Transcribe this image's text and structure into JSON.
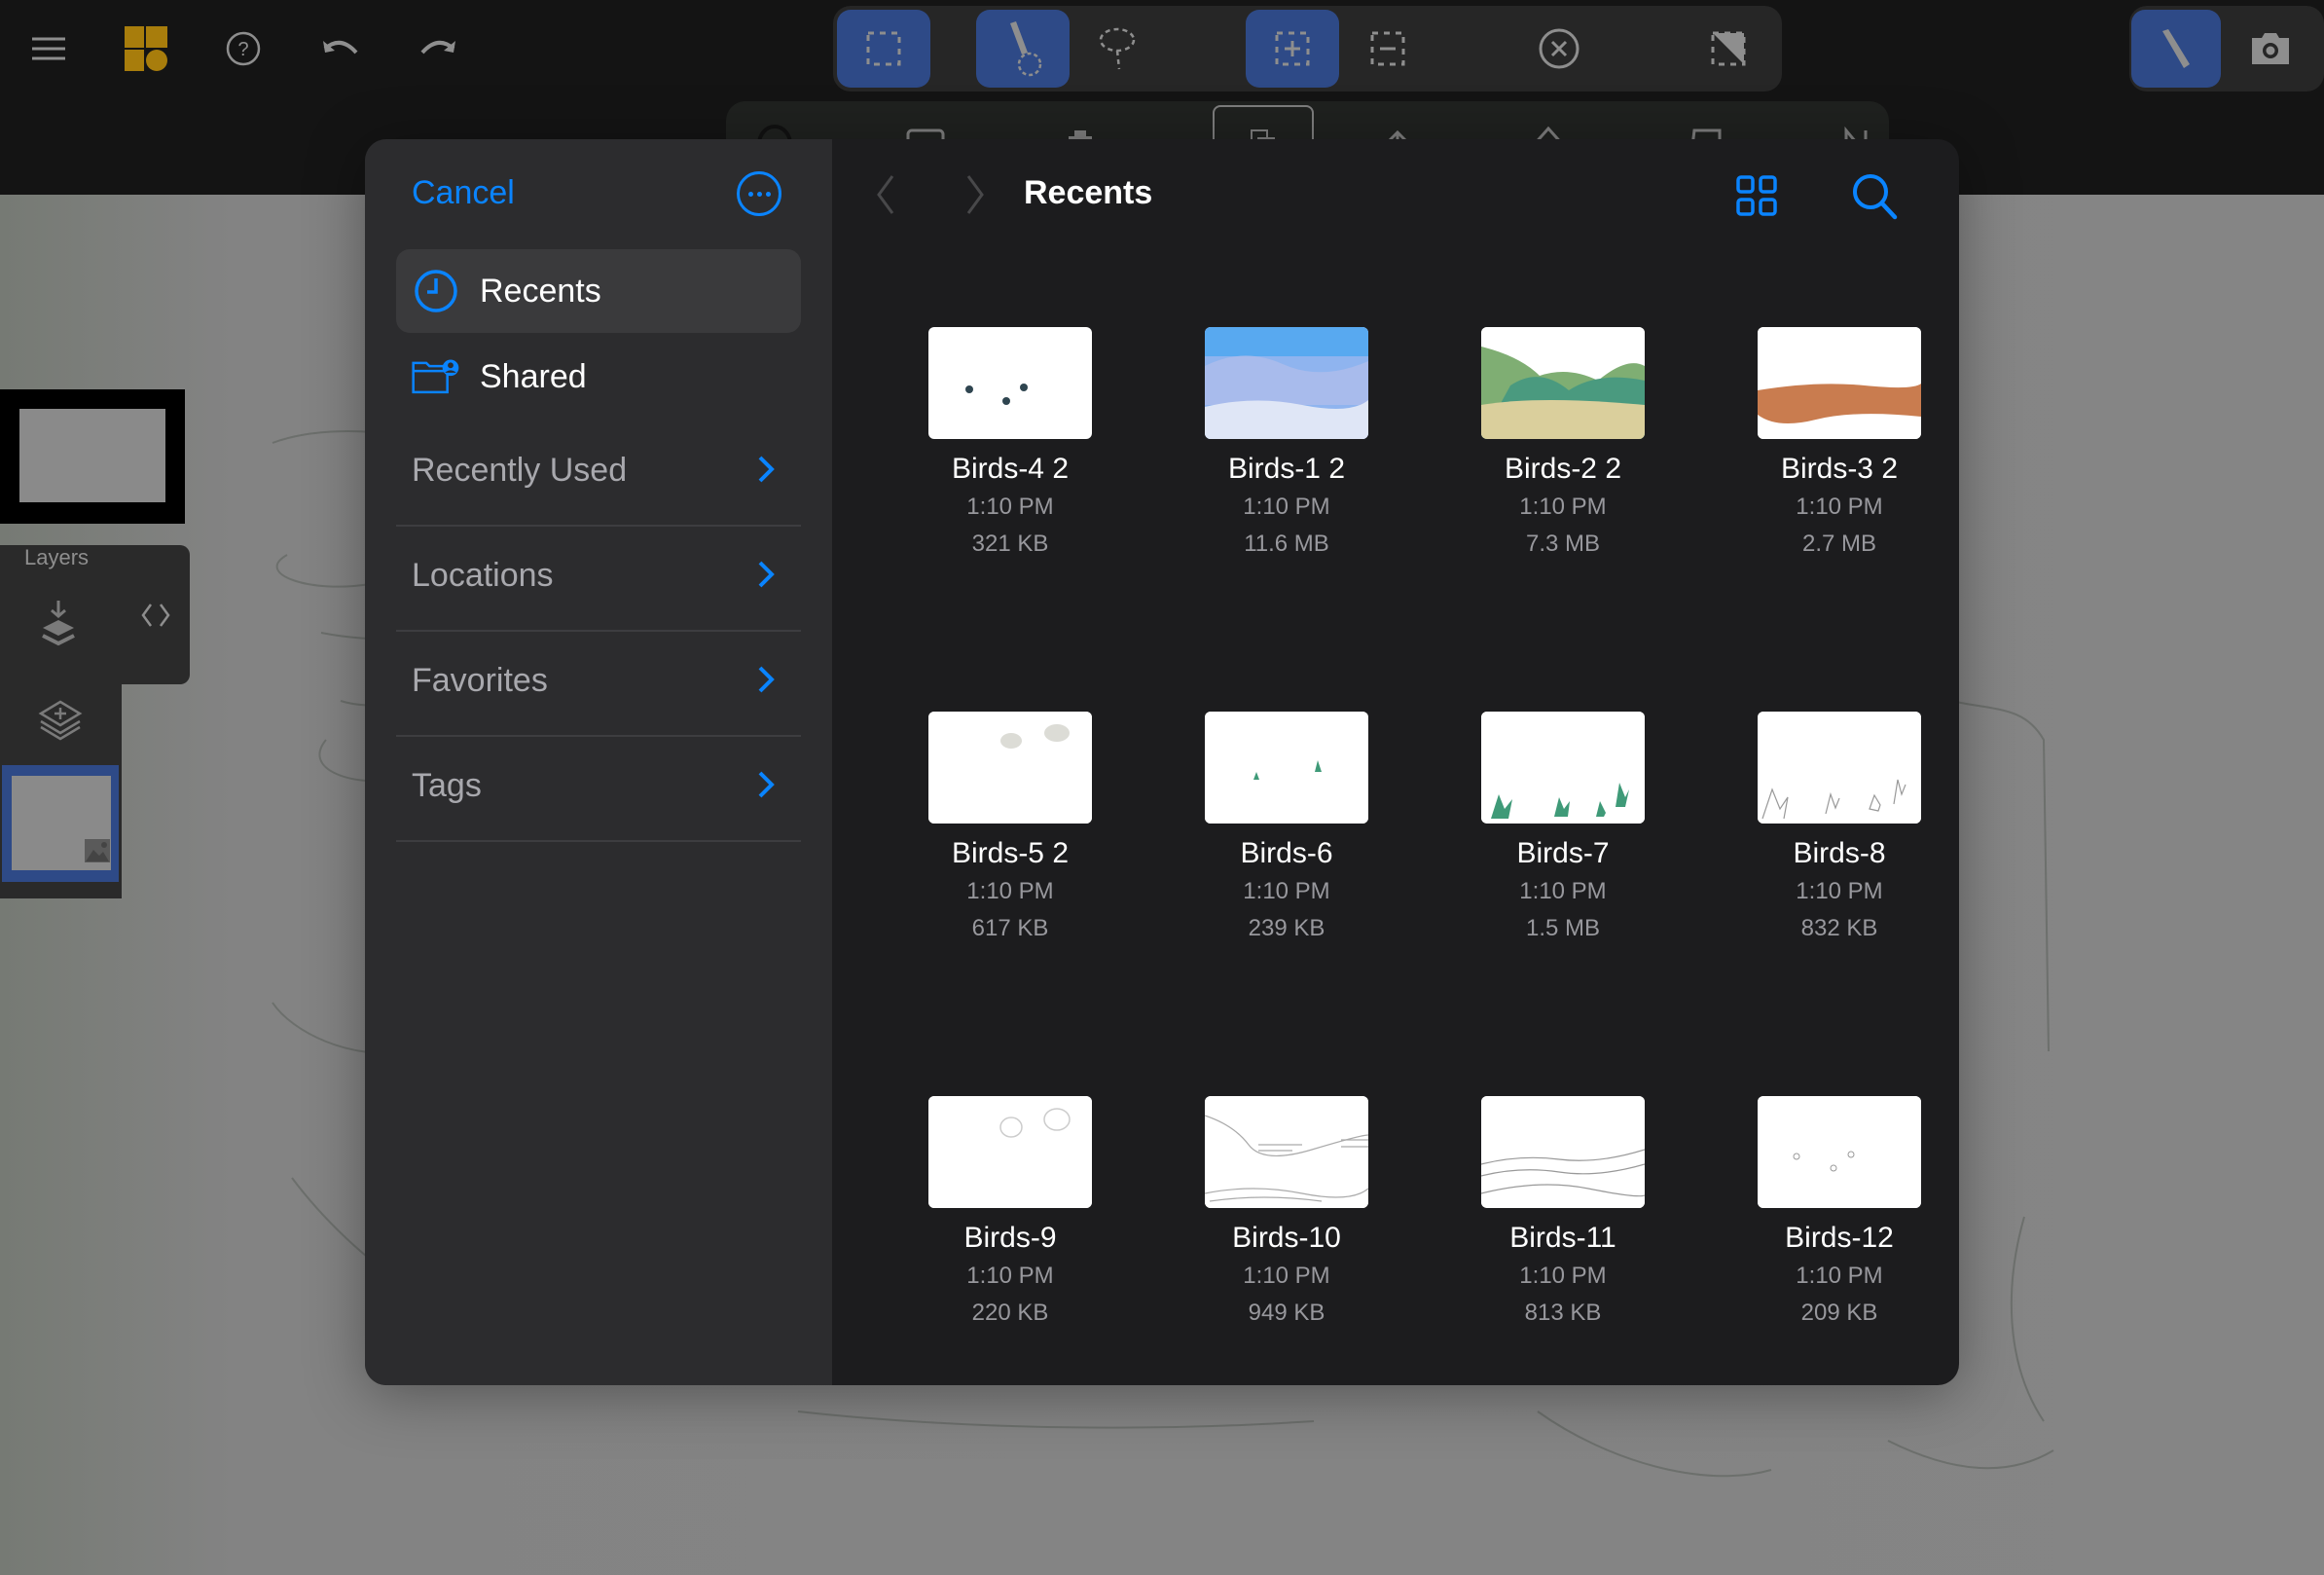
{
  "toolbar": {
    "left_icons": [
      "menu-icon",
      "app-logo-icon",
      "help-icon",
      "undo-icon",
      "redo-icon"
    ],
    "selection_tools": [
      {
        "name": "rectangle-select-icon",
        "active": true
      },
      {
        "name": "brush-select-icon",
        "active": true
      },
      {
        "name": "lasso-select-icon",
        "active": false
      },
      {
        "name": "add-selection-icon",
        "active": true
      },
      {
        "name": "subtract-selection-icon",
        "active": false
      },
      {
        "name": "clear-selection-icon",
        "active": false
      },
      {
        "name": "invert-selection-icon",
        "active": false
      }
    ],
    "right_tools": [
      {
        "name": "brush-icon",
        "active": true
      },
      {
        "name": "camera-icon",
        "active": false
      }
    ]
  },
  "layers_panel": {
    "title": "Layers"
  },
  "file_picker": {
    "cancel_label": "Cancel",
    "accent_color": "#0a84ff",
    "sidebar": {
      "items": [
        {
          "label": "Recents",
          "icon": "clock-icon",
          "active": true
        },
        {
          "label": "Shared",
          "icon": "shared-folder-icon",
          "active": false
        }
      ],
      "sections": [
        {
          "label": "Recently Used"
        },
        {
          "label": "Locations"
        },
        {
          "label": "Favorites"
        },
        {
          "label": "Tags"
        }
      ]
    },
    "header": {
      "title": "Recents"
    },
    "files": [
      {
        "name": "Birds-4 2",
        "time": "1:10 PM",
        "size": "321 KB",
        "thumb": "birds"
      },
      {
        "name": "Birds-1 2",
        "time": "1:10 PM",
        "size": "11.6 MB",
        "thumb": "sky"
      },
      {
        "name": "Birds-2 2",
        "time": "1:10 PM",
        "size": "7.3 MB",
        "thumb": "hills"
      },
      {
        "name": "Birds-3 2",
        "time": "1:10 PM",
        "size": "2.7 MB",
        "thumb": "band"
      },
      {
        "name": "Birds-5 2",
        "time": "1:10 PM",
        "size": "617 KB",
        "thumb": "blobs"
      },
      {
        "name": "Birds-6",
        "time": "1:10 PM",
        "size": "239 KB",
        "thumb": "sprigs"
      },
      {
        "name": "Birds-7",
        "time": "1:10 PM",
        "size": "1.5 MB",
        "thumb": "grass"
      },
      {
        "name": "Birds-8",
        "time": "1:10 PM",
        "size": "832 KB",
        "thumb": "grass-sketch"
      },
      {
        "name": "Birds-9",
        "time": "1:10 PM",
        "size": "220 KB",
        "thumb": "circles"
      },
      {
        "name": "Birds-10",
        "time": "1:10 PM",
        "size": "949 KB",
        "thumb": "lines"
      },
      {
        "name": "Birds-11",
        "time": "1:10 PM",
        "size": "813 KB",
        "thumb": "waves"
      },
      {
        "name": "Birds-12",
        "time": "1:10 PM",
        "size": "209 KB",
        "thumb": "birds-sketch"
      }
    ]
  }
}
